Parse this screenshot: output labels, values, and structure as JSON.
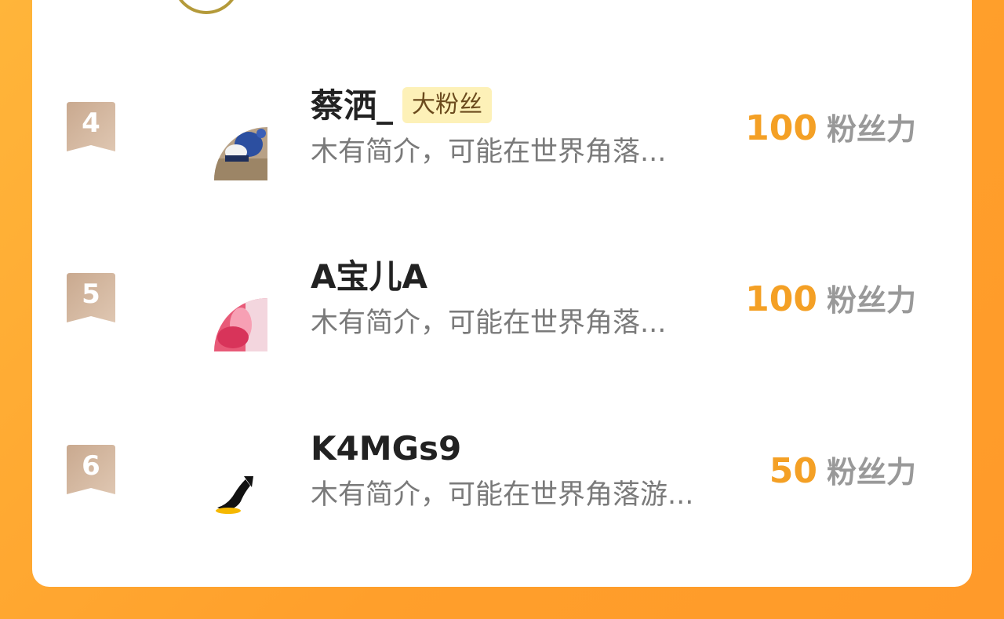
{
  "colors": {
    "background": "#ff9f2b",
    "card": "#ffffff",
    "accent_value": "#f4a025",
    "rank_badge": "#d4b49a",
    "fan_tag_bg": "#fdf1b8"
  },
  "ranking": [
    {
      "rank": "4",
      "name": "蔡洒_",
      "tag": "大粉丝",
      "bio": "木有简介，可能在世界角落...",
      "fan_value": "100",
      "fan_unit": "粉丝力",
      "avatar_icon": "person-photo-avatar"
    },
    {
      "rank": "5",
      "name": "A宝儿A",
      "bio": "木有简介，可能在世界角落...",
      "fan_value": "100",
      "fan_unit": "粉丝力",
      "avatar_icon": "pink-photo-avatar"
    },
    {
      "rank": "6",
      "name": "K4MGs9",
      "bio": "木有简介，可能在世界角落游...",
      "fan_value": "50",
      "fan_unit": "粉丝力",
      "avatar_icon": "penguin-logo-avatar"
    }
  ]
}
